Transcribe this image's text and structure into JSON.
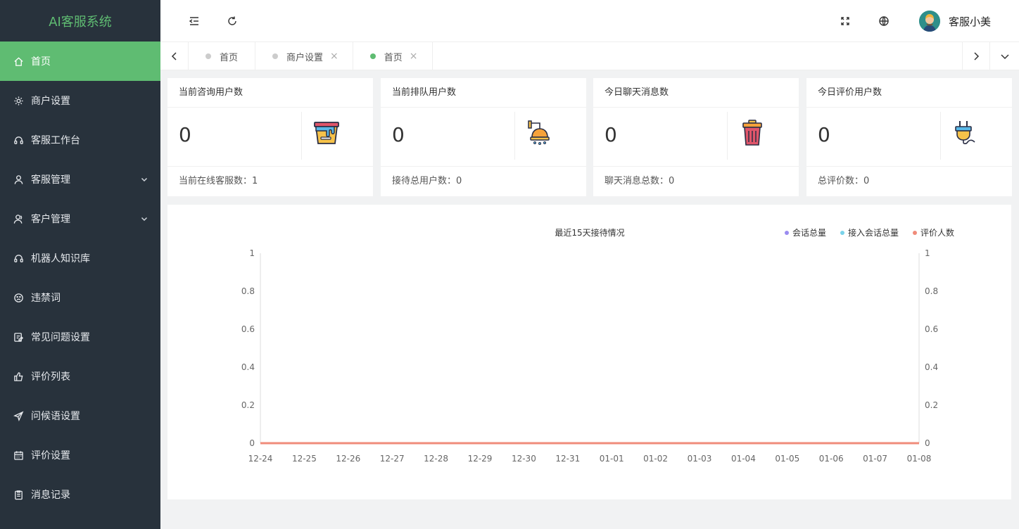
{
  "app": {
    "title": "AI客服系统"
  },
  "sidebar": {
    "items": [
      {
        "label": "首页",
        "icon": "home-icon",
        "active": true
      },
      {
        "label": "商户设置",
        "icon": "gear-icon"
      },
      {
        "label": "客服工作台",
        "icon": "headset-icon"
      },
      {
        "label": "客服管理",
        "icon": "user-icon",
        "expandable": true
      },
      {
        "label": "客户管理",
        "icon": "users-icon",
        "expandable": true
      },
      {
        "label": "机器人知识库",
        "icon": "headset-icon"
      },
      {
        "label": "违禁词",
        "icon": "sad-face-icon"
      },
      {
        "label": "常见问题设置",
        "icon": "edit-icon"
      },
      {
        "label": "评价列表",
        "icon": "thumbs-up-icon"
      },
      {
        "label": "问候语设置",
        "icon": "send-icon"
      },
      {
        "label": "评价设置",
        "icon": "calendar-icon"
      },
      {
        "label": "消息记录",
        "icon": "clipboard-icon"
      }
    ]
  },
  "header": {
    "user_name": "客服小美"
  },
  "tabs": [
    {
      "label": "首页",
      "closable": false,
      "active": false
    },
    {
      "label": "商户设置",
      "closable": true,
      "active": false
    },
    {
      "label": "首页",
      "closable": true,
      "active": true
    }
  ],
  "cards": [
    {
      "title": "当前咨询用户数",
      "value": "0",
      "footer": "当前在线客服数：1",
      "icon": "paint-bucket-icon"
    },
    {
      "title": "当前排队用户数",
      "value": "0",
      "footer": "接待总用户数：0",
      "icon": "shower-icon"
    },
    {
      "title": "今日聊天消息数",
      "value": "0",
      "footer": "聊天消息总数：0",
      "icon": "trash-bin-icon"
    },
    {
      "title": "今日评价用户数",
      "value": "0",
      "footer": "总评价数：0",
      "icon": "plug-icon"
    }
  ],
  "colors": {
    "sidebar_bg": "#28323c",
    "accent": "#5fbc72",
    "series": [
      "#9a8cf0",
      "#7ad3ea",
      "#f08c7a"
    ]
  },
  "chart_data": {
    "type": "line",
    "title": "最近15天接待情况",
    "categories": [
      "12-24",
      "12-25",
      "12-26",
      "12-27",
      "12-28",
      "12-29",
      "12-30",
      "12-31",
      "01-01",
      "01-02",
      "01-03",
      "01-04",
      "01-05",
      "01-06",
      "01-07",
      "01-08"
    ],
    "yticks": [
      "0",
      "0.2",
      "0.4",
      "0.6",
      "0.8",
      "1"
    ],
    "ylim": [
      0,
      1
    ],
    "legend_position": "top-right",
    "series": [
      {
        "name": "会话总量",
        "values": [
          0,
          0,
          0,
          0,
          0,
          0,
          0,
          0,
          0,
          0,
          0,
          0,
          0,
          0,
          0,
          0
        ]
      },
      {
        "name": "接入会话总量",
        "values": [
          0,
          0,
          0,
          0,
          0,
          0,
          0,
          0,
          0,
          0,
          0,
          0,
          0,
          0,
          0,
          0
        ]
      },
      {
        "name": "评价人数",
        "values": [
          0,
          0,
          0,
          0,
          0,
          0,
          0,
          0,
          0,
          0,
          0,
          0,
          0,
          0,
          0,
          0
        ]
      }
    ]
  }
}
